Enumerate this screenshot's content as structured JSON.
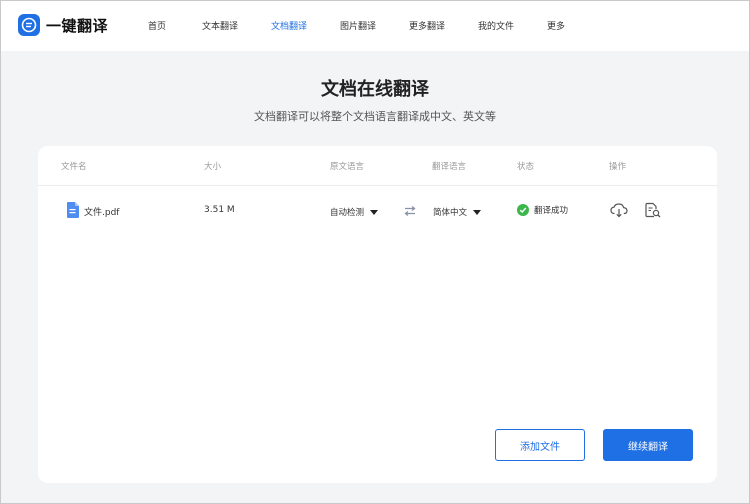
{
  "app": {
    "name": "一键翻译"
  },
  "nav": {
    "items": [
      {
        "label": "首页",
        "active": false
      },
      {
        "label": "文本翻译",
        "active": false
      },
      {
        "label": "文档翻译",
        "active": true
      },
      {
        "label": "图片翻译",
        "active": false
      },
      {
        "label": "更多翻译",
        "active": false
      },
      {
        "label": "我的文件",
        "active": false
      },
      {
        "label": "更多",
        "active": false
      }
    ]
  },
  "page": {
    "title": "文档在线翻译",
    "subtitle": "文档翻译可以将整个文档语言翻译成中文、英文等"
  },
  "table": {
    "headers": {
      "filename": "文件名",
      "size": "大小",
      "source_lang": "原文语言",
      "target_lang": "翻译语言",
      "status": "状态",
      "actions": "操作"
    },
    "rows": [
      {
        "filename": "文件.pdf",
        "size": "3.51 M",
        "source_lang": "自动检测",
        "target_lang": "简体中文",
        "status": "翻译成功"
      }
    ]
  },
  "buttons": {
    "add_file": "添加文件",
    "continue": "继续翻译"
  },
  "colors": {
    "accent": "#1f6fe5",
    "success": "#3bb64a",
    "background": "#f3f4f6"
  },
  "icons": {
    "logo": "translate-bubble-icon",
    "file": "document-icon",
    "swap": "swap-arrows-icon",
    "status": "check-circle-icon",
    "download": "cloud-download-icon",
    "preview": "document-search-icon"
  }
}
